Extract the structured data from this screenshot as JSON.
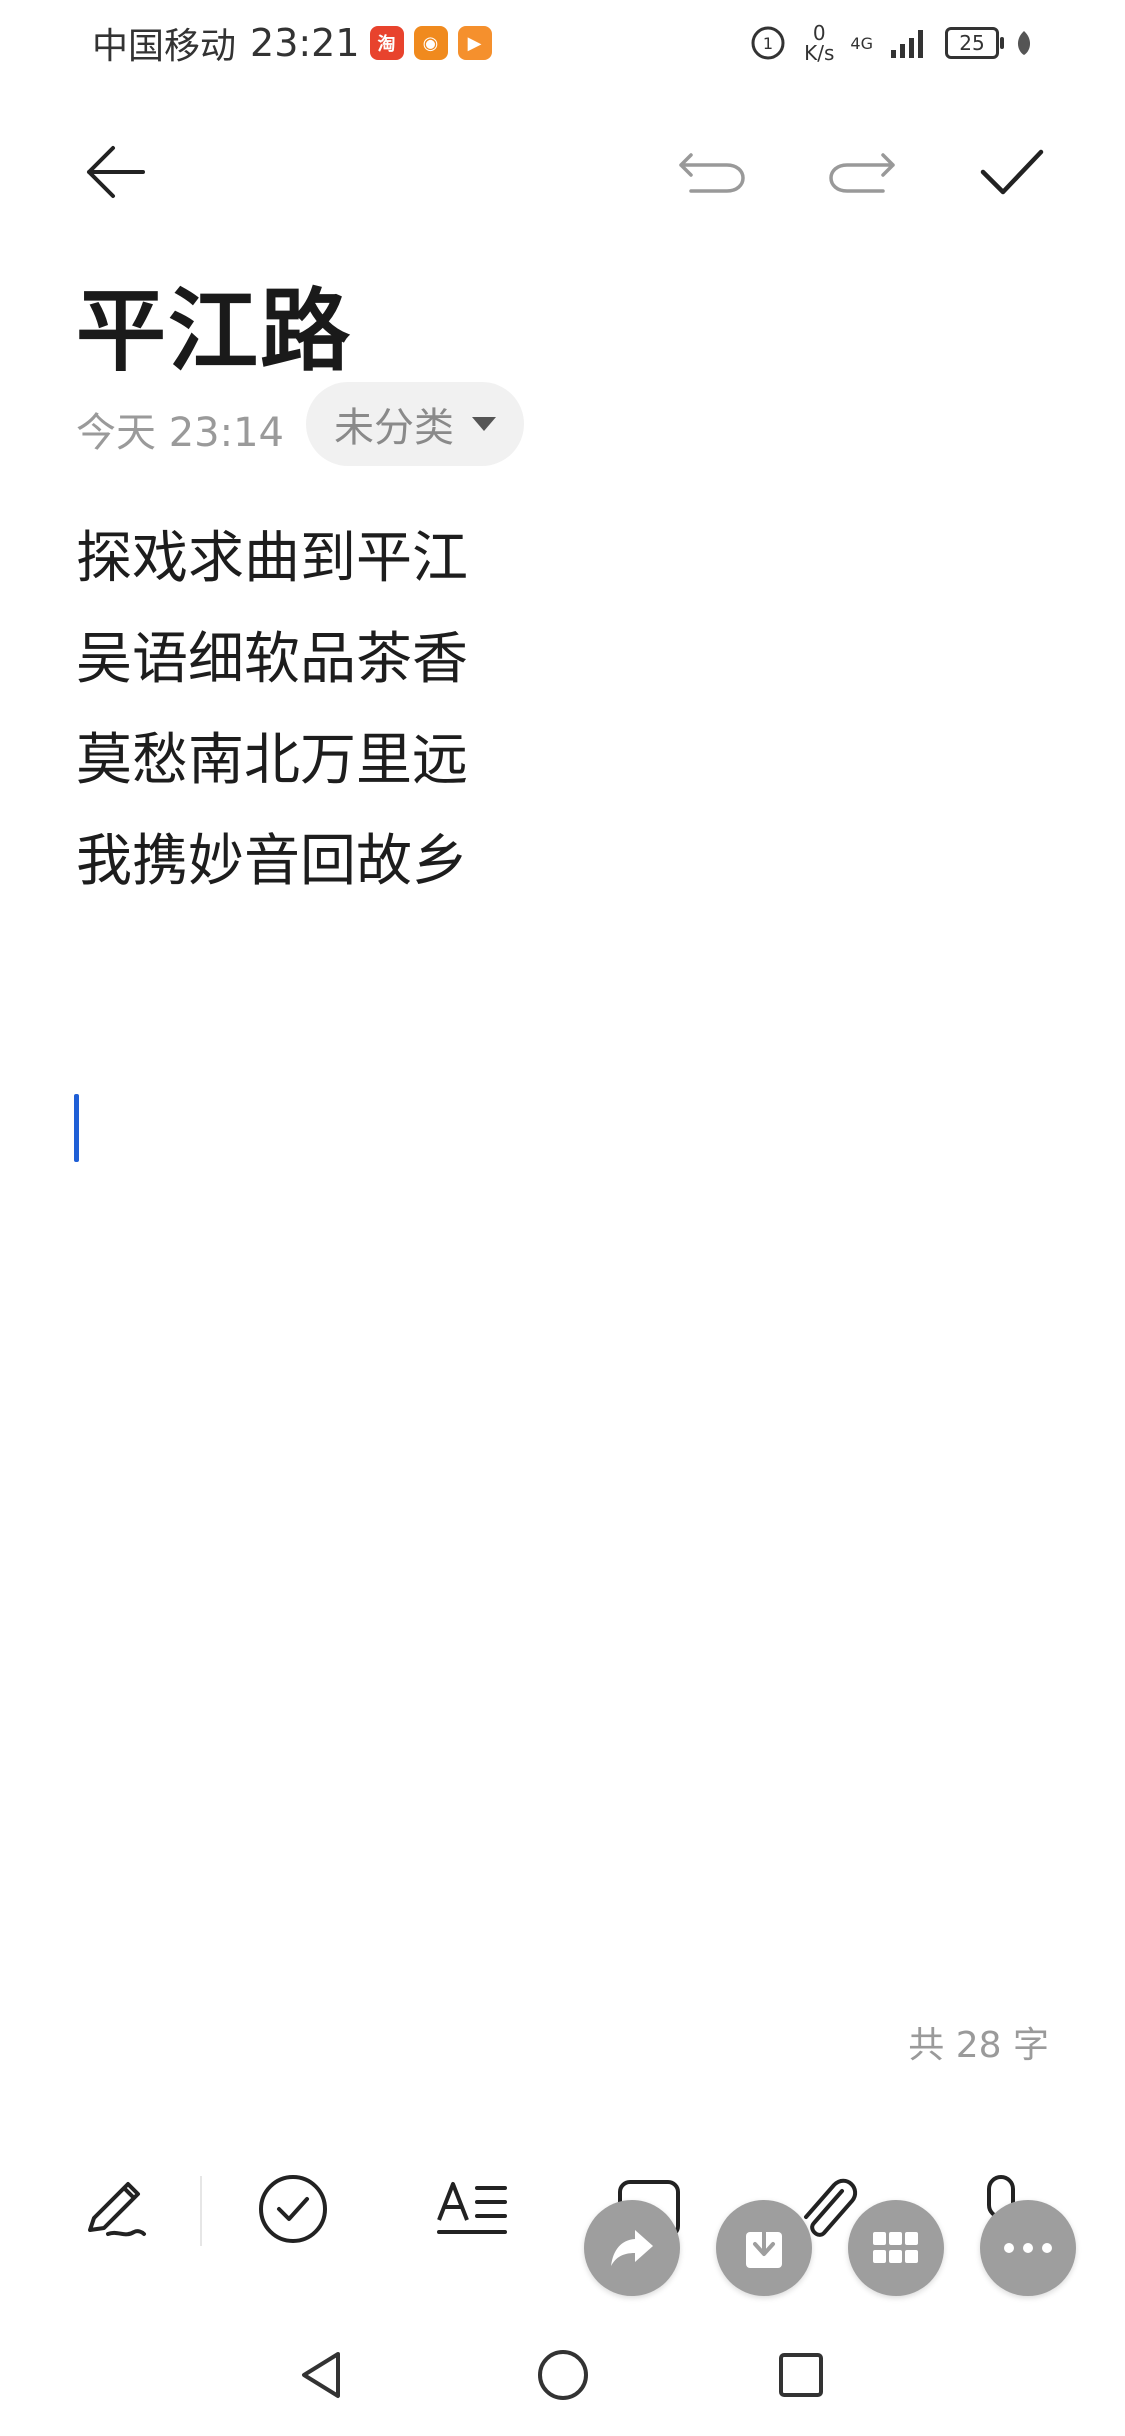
{
  "status_bar": {
    "carrier": "中国移动",
    "time": "23:21",
    "net_speed_value": "0",
    "net_speed_unit": "K/s",
    "network": "4G",
    "battery": "25"
  },
  "toolbar": {
    "back_icon": "arrow-left-icon",
    "undo_icon": "undo-icon",
    "redo_icon": "redo-icon",
    "done_icon": "checkmark-icon"
  },
  "note": {
    "title": "平江路",
    "date": "今天 23:14",
    "category": "未分类",
    "lines": [
      "探戏求曲到平江",
      "吴语细软品茶香",
      "莫愁南北万里远",
      "我携妙音回故乡"
    ],
    "word_count": "共 28 字"
  },
  "bottom_tools": [
    "handwriting-icon",
    "checklist-icon",
    "text-style-icon",
    "image-icon",
    "attachment-icon",
    "voice-icon"
  ],
  "fab_buttons": [
    "share-icon",
    "save-icon",
    "grid-icon",
    "more-icon"
  ],
  "accent_color": "#1f5fd6",
  "fab_color": "#9e9e9e"
}
